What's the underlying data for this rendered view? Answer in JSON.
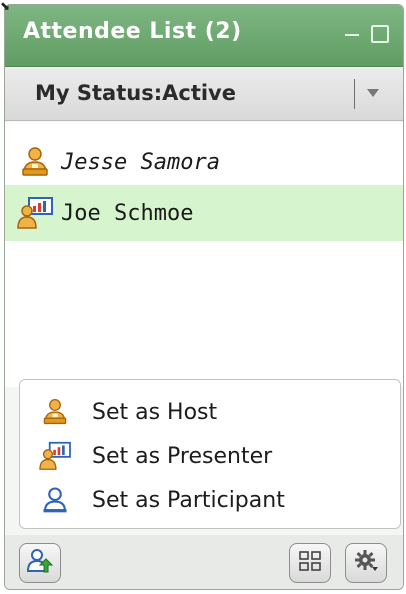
{
  "panel": {
    "title": "Attendee List (2)"
  },
  "status": {
    "label": "My Status:Active"
  },
  "attendees": [
    {
      "name": "Jesse Samora",
      "role_icon": "host-icon",
      "selected": false
    },
    {
      "name": "Joe Schmoe",
      "role_icon": "presenter-icon",
      "selected": true
    }
  ],
  "role_menu": {
    "items": [
      {
        "label": "Set as Host",
        "icon": "host-icon"
      },
      {
        "label": "Set as Presenter",
        "icon": "presenter-icon"
      },
      {
        "label": "Set as Participant",
        "icon": "participant-icon"
      }
    ]
  },
  "toolbar": {
    "left_icon": "user-upload-icon",
    "right_icons": [
      "layout-grid-icon",
      "settings-gear-icon"
    ]
  },
  "colors": {
    "titlebar": "#6aa86e",
    "selected_row": "#d6f5cf",
    "host_icon": "#e29a1e",
    "participant_icon": "#2f63b6"
  }
}
